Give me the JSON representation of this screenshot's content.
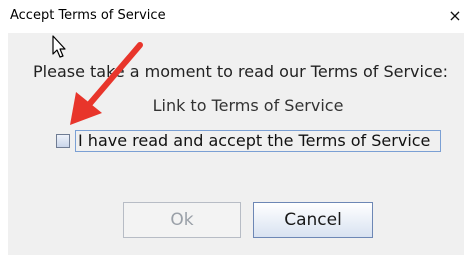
{
  "window": {
    "title": "Accept Terms of Service",
    "close_glyph": "×"
  },
  "dialog": {
    "prompt": "Please take a moment to read our Terms of Service:",
    "link_label": "Link to Terms of Service",
    "checkbox": {
      "label": "I have read and accept the Terms of Service",
      "checked": false
    },
    "buttons": {
      "ok": {
        "label": "Ok",
        "enabled": false
      },
      "cancel": {
        "label": "Cancel",
        "enabled": true
      }
    }
  },
  "annotation": {
    "icon": "red-arrow-icon",
    "color": "#e8352b"
  },
  "colors": {
    "focus_border": "#7ba0d4",
    "disabled_text": "#9aa0a8"
  }
}
